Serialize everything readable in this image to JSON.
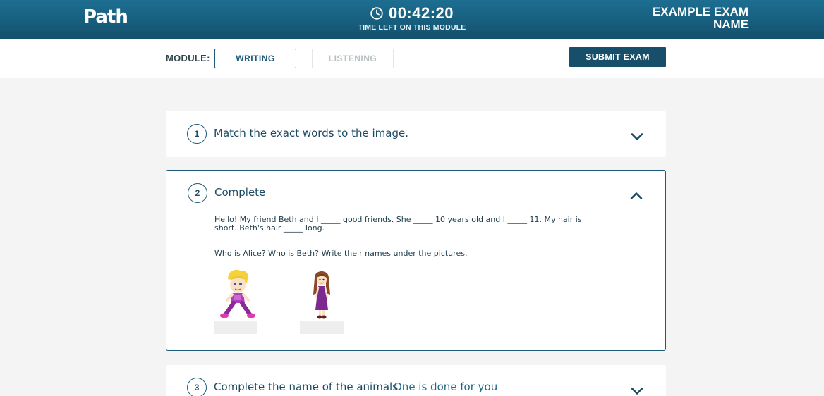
{
  "header": {
    "logo": "Path",
    "timer": "00:42:20",
    "timer_caption": "TIME LEFT ON THIS MODULE",
    "exam_name_line1": "EXAMPLE EXAM",
    "exam_name_line2": "NAME"
  },
  "modules": {
    "label": "MODULE:",
    "items": [
      {
        "label": "WRITING",
        "state": "active"
      },
      {
        "label": "LISTENING",
        "state": "disabled"
      }
    ],
    "submit_label": "SUBMIT EXAM"
  },
  "questions": [
    {
      "number": "1",
      "title": "Match the exact words to the image.",
      "expanded": false
    },
    {
      "number": "2",
      "title": "Complete",
      "expanded": true,
      "text": "Hello! My friend Beth and I _____ good friends. She _____ 10 years old and I _____ 11. My hair is short. Beth's hair _____ long.",
      "subtext": "Who is Alice? Who is Beth? Write their names under the pictures.",
      "pictures": [
        {
          "icon": "girl-blonde-short-hair-icon",
          "answer": ""
        },
        {
          "icon": "girl-brown-long-hair-icon",
          "answer": ""
        }
      ]
    },
    {
      "number": "3",
      "title": "Complete the name of the animals.",
      "note": "One is done for you",
      "expanded": false
    }
  ],
  "colors": {
    "header_bg": "#175d7c",
    "accent": "#1b5a78",
    "submit_bg": "#174f6b",
    "page_bg": "#f4f4f4"
  }
}
